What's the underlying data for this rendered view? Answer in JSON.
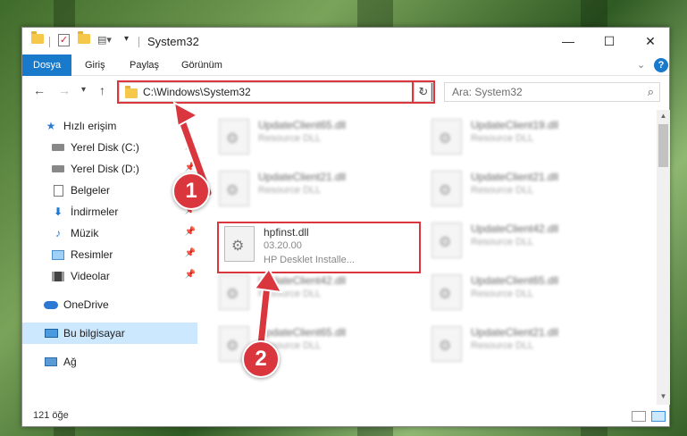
{
  "window": {
    "title": "System32"
  },
  "ribbon": {
    "tabs": [
      "Dosya",
      "Giriş",
      "Paylaş",
      "Görünüm"
    ],
    "active_tab": "Dosya"
  },
  "nav": {
    "address": "C:\\Windows\\System32",
    "search_placeholder": "Ara: System32"
  },
  "sidebar": {
    "items": [
      {
        "label": "Hızlı erişim",
        "icon": "star-icon"
      },
      {
        "label": "Yerel Disk (C:)",
        "icon": "drive-icon",
        "pinned": true
      },
      {
        "label": "Yerel Disk (D:)",
        "icon": "drive-icon",
        "pinned": true
      },
      {
        "label": "Belgeler",
        "icon": "documents-icon",
        "pinned": true
      },
      {
        "label": "İndirmeler",
        "icon": "downloads-icon",
        "pinned": true
      },
      {
        "label": "Müzik",
        "icon": "music-icon",
        "pinned": true
      },
      {
        "label": "Resimler",
        "icon": "pictures-icon",
        "pinned": true
      },
      {
        "label": "Videolar",
        "icon": "videos-icon",
        "pinned": true
      },
      {
        "label": "OneDrive",
        "icon": "cloud-icon"
      },
      {
        "label": "Bu bilgisayar",
        "icon": "computer-icon",
        "selected": true
      },
      {
        "label": "Ağ",
        "icon": "network-icon"
      }
    ]
  },
  "files": {
    "highlighted": {
      "name": "hpfinst.dll",
      "version": "03.20.00",
      "description": "HP Desklet Installe..."
    },
    "blurred": [
      {
        "name": "UpdateClient65.dll",
        "type": "Resource DLL"
      },
      {
        "name": "UpdateClient19.dll",
        "type": "Resource DLL"
      },
      {
        "name": "UpdateClient21.dll",
        "type": "Resource DLL"
      },
      {
        "name": "UpdateClient21.dll",
        "type": "Resource DLL"
      },
      {
        "name": "UpdateClient42.dll",
        "type": "Resource DLL"
      },
      {
        "name": "UpdateClient42.dll",
        "type": "Resource DLL"
      },
      {
        "name": "UpdateClient65.dll",
        "type": "Resource DLL"
      },
      {
        "name": "UpdateClient65.dll",
        "type": "Resource DLL"
      },
      {
        "name": "UpdateClient21.dll",
        "type": "Resource DLL"
      }
    ]
  },
  "status": {
    "item_count": "121 öğe"
  },
  "callouts": {
    "one": "1",
    "two": "2"
  },
  "colors": {
    "accent": "#1979ca",
    "highlight": "#d9363e",
    "selected": "#cce8ff"
  }
}
